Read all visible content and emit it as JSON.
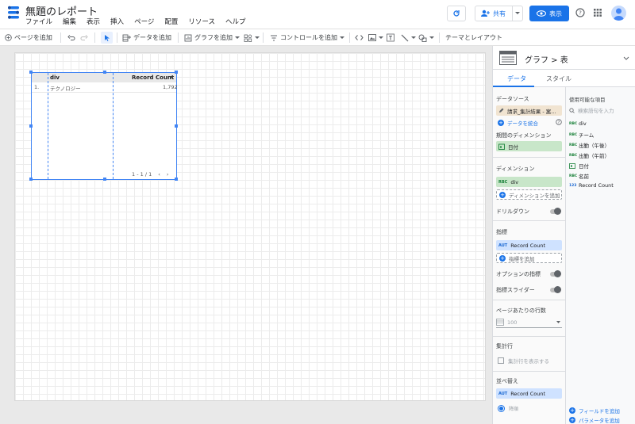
{
  "header": {
    "title": "無題のレポート",
    "menu": [
      "ファイル",
      "編集",
      "表示",
      "挿入",
      "ページ",
      "配置",
      "リソース",
      "ヘルプ"
    ],
    "share_label": "共有",
    "view_label": "表示"
  },
  "toolbar": {
    "add_page": "ページを追加",
    "add_data": "データを追加",
    "add_chart": "グラフを追加",
    "add_control": "コントロールを追加",
    "theme_layout": "テーマとレイアウト"
  },
  "table": {
    "headers": [
      "div",
      "Record Count"
    ],
    "rows": [
      {
        "index": "1.",
        "div": "テクノロジー",
        "count": "1,792"
      }
    ],
    "pager": "1 - 1 / 1"
  },
  "panel": {
    "title": "グラフ > 表",
    "tab_data": "データ",
    "tab_style": "スタイル",
    "datasource_title": "データソース",
    "datasource_name": "請求_集計結果 - 案...",
    "blend": "データを統合",
    "date_dim_title": "期間のディメンション",
    "date_dim": "日付",
    "dimension_title": "ディメンション",
    "dimension": "div",
    "add_dimension": "ディメンションを追加",
    "drilldown": "ドリルダウン",
    "metric_title": "指標",
    "metric": "Record Count",
    "add_metric": "指標を追加",
    "optional_metric": "オプションの指標",
    "metric_slider": "指標スライダー",
    "rows_per_page_title": "ページあたりの行数",
    "rows_per_page": "100",
    "summary_title": "集計行",
    "summary_checkbox": "集計行を表示する",
    "sort_title": "並べ替え",
    "sort_field": "Record Count",
    "sort_order": "降順"
  },
  "fields": {
    "title": "使用可能な項目",
    "search_placeholder": "検索語句を入力",
    "items": [
      {
        "type": "ABC",
        "name": "div"
      },
      {
        "type": "ABC",
        "name": "チーム"
      },
      {
        "type": "ABC",
        "name": "出勤（午後）"
      },
      {
        "type": "ABC",
        "name": "出勤（午前）"
      },
      {
        "type": "DATE",
        "name": "日付"
      },
      {
        "type": "ABC",
        "name": "名前"
      },
      {
        "type": "123",
        "name": "Record Count"
      }
    ],
    "add_field": "フィールドを追加",
    "add_parameter": "パラメータを追加"
  }
}
